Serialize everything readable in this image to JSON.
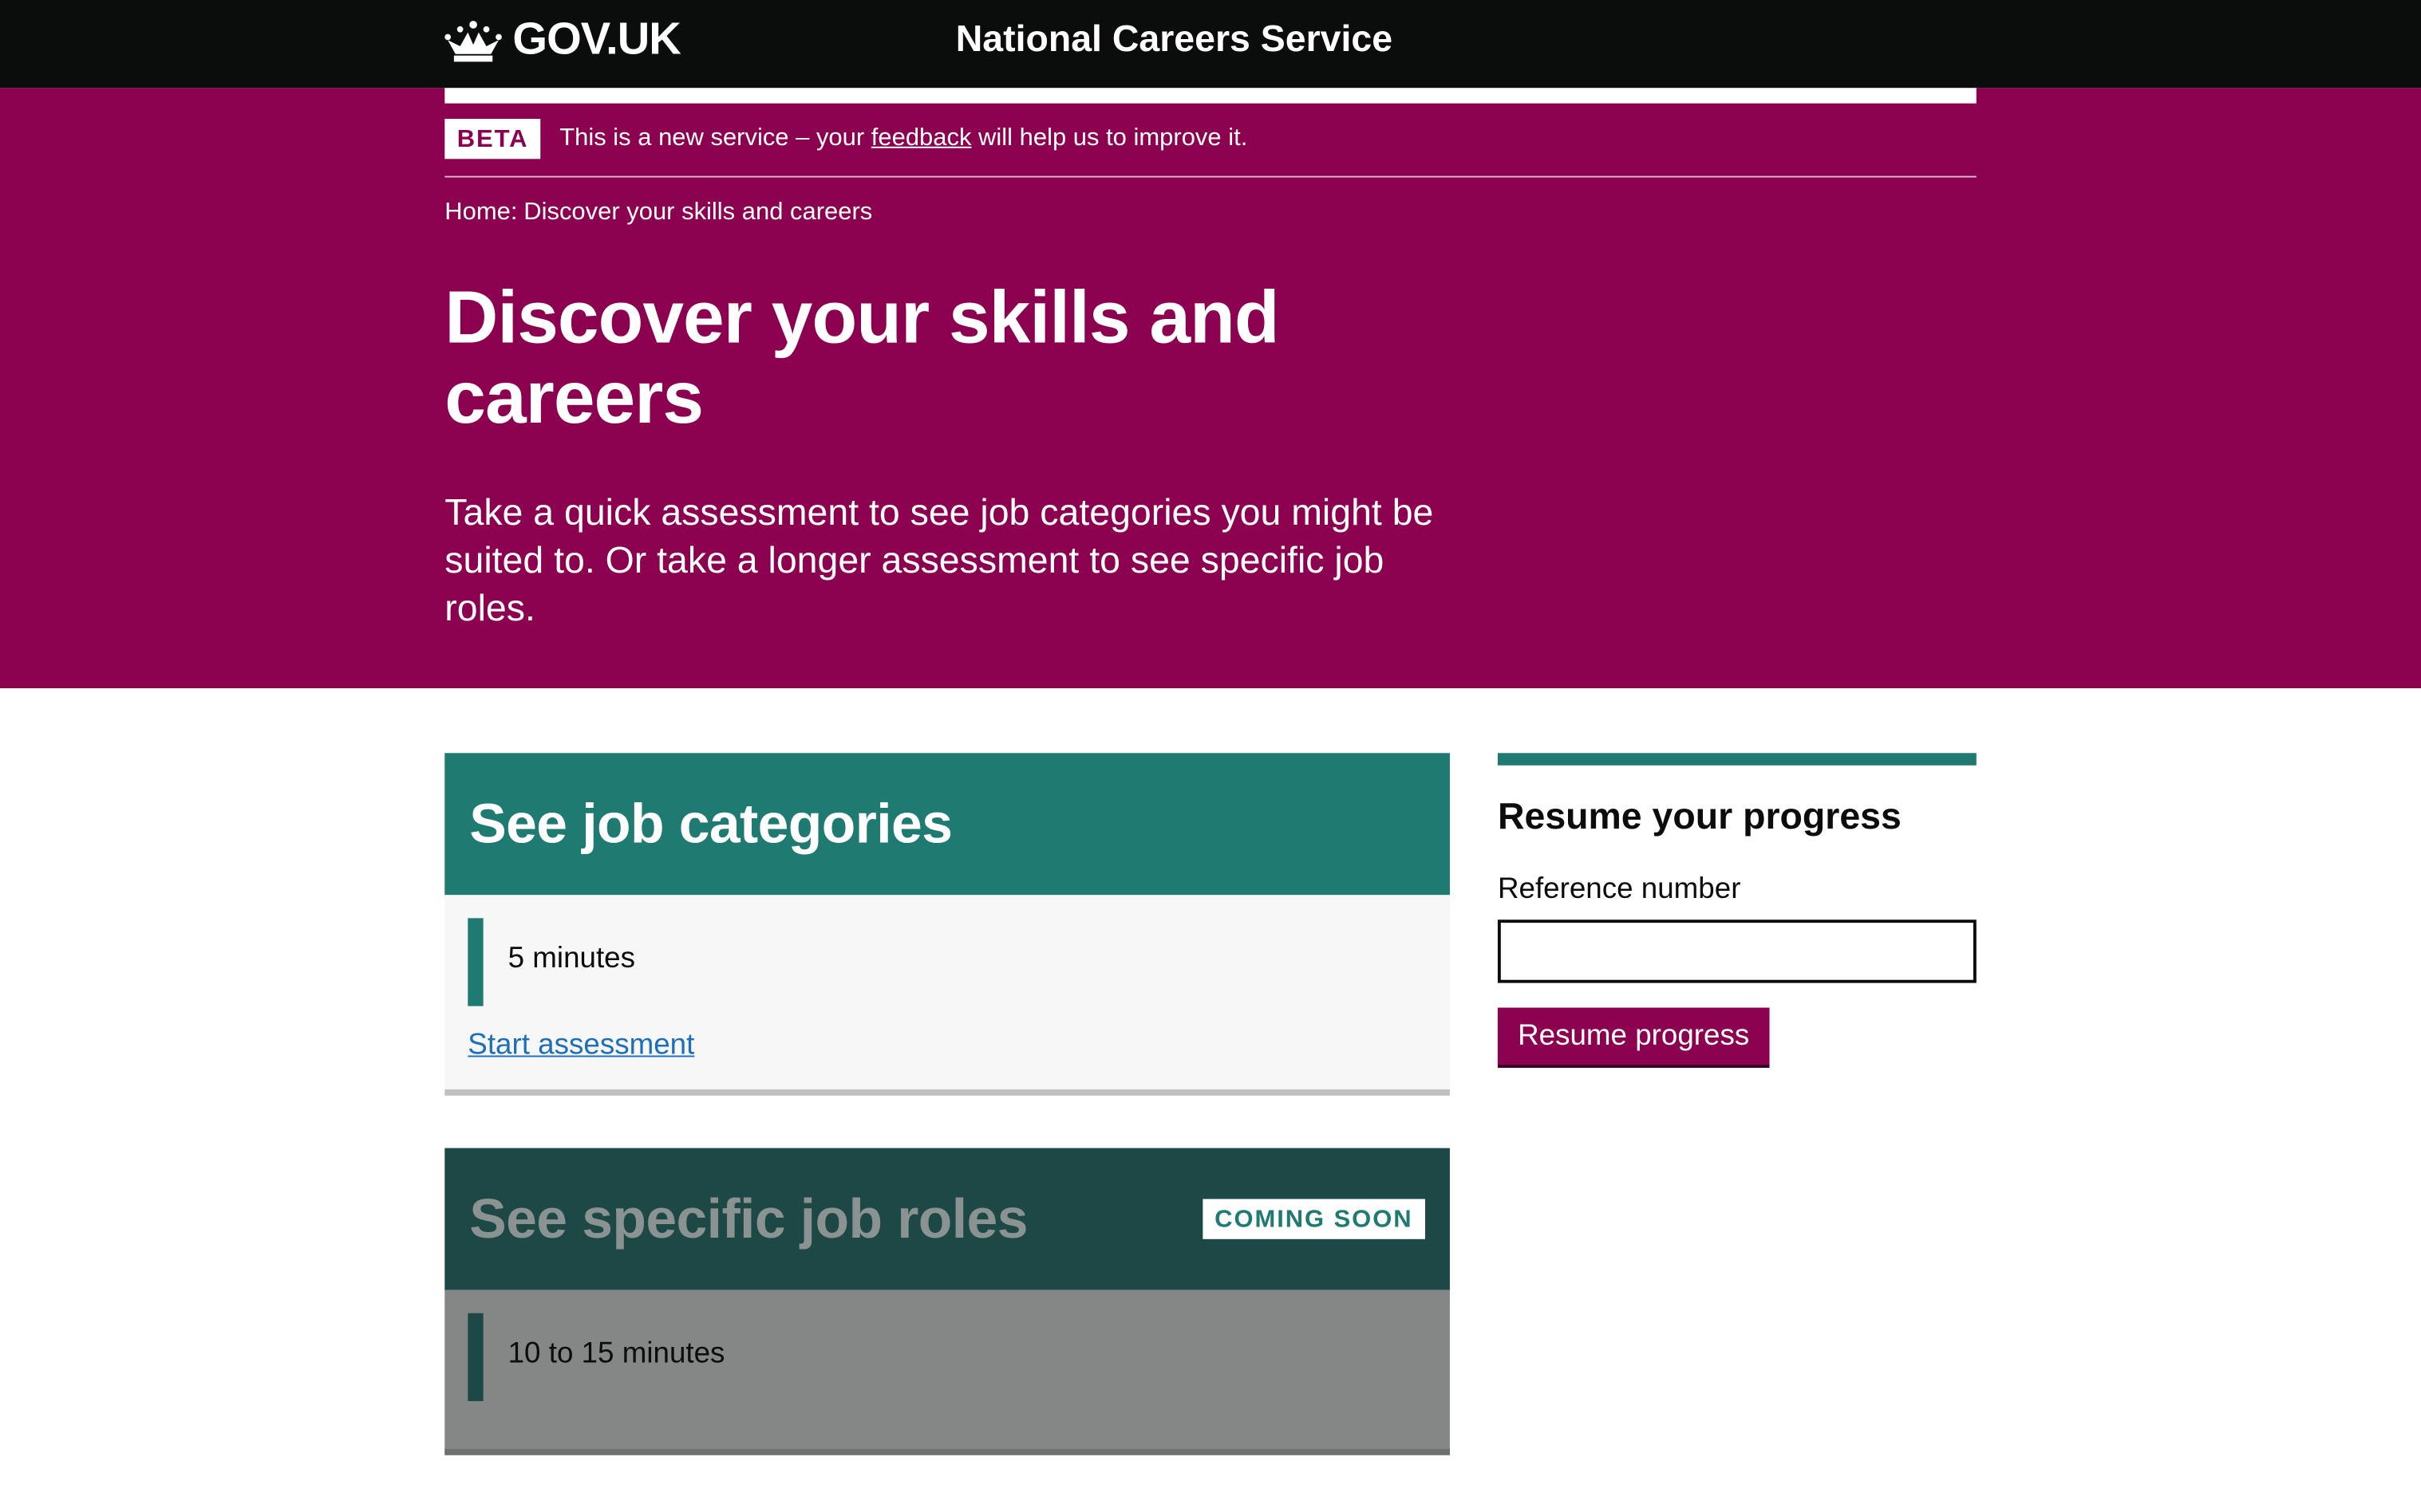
{
  "header": {
    "logo_text": "GOV.UK",
    "logo_icon": "crown-icon",
    "service_name": "National Careers Service"
  },
  "phase_banner": {
    "tag": "BETA",
    "text_before": "This is a new service – your ",
    "link_text": "feedback",
    "text_after": " will help us to improve it."
  },
  "breadcrumb": {
    "home": "Home",
    "current": "Discover your skills and careers"
  },
  "hero": {
    "title": "Discover your skills and careers",
    "lede": "Take a quick assessment to see job categories you might be suited to. Or take a longer assessment to see specific job roles."
  },
  "cards": [
    {
      "title": "See job categories",
      "duration": "5 minutes",
      "link": "Start assessment"
    },
    {
      "title": "See specific job roles",
      "tag": "COMING SOON",
      "duration": "10 to 15 minutes"
    }
  ],
  "resume": {
    "heading": "Resume your progress",
    "label": "Reference number",
    "input_value": "",
    "button": "Resume progress"
  },
  "colors": {
    "header": "#0b0c0c",
    "brand": "#8c0050",
    "teal": "#1f7a72",
    "dark_teal": "#1d4845",
    "link": "#1d70b8"
  }
}
